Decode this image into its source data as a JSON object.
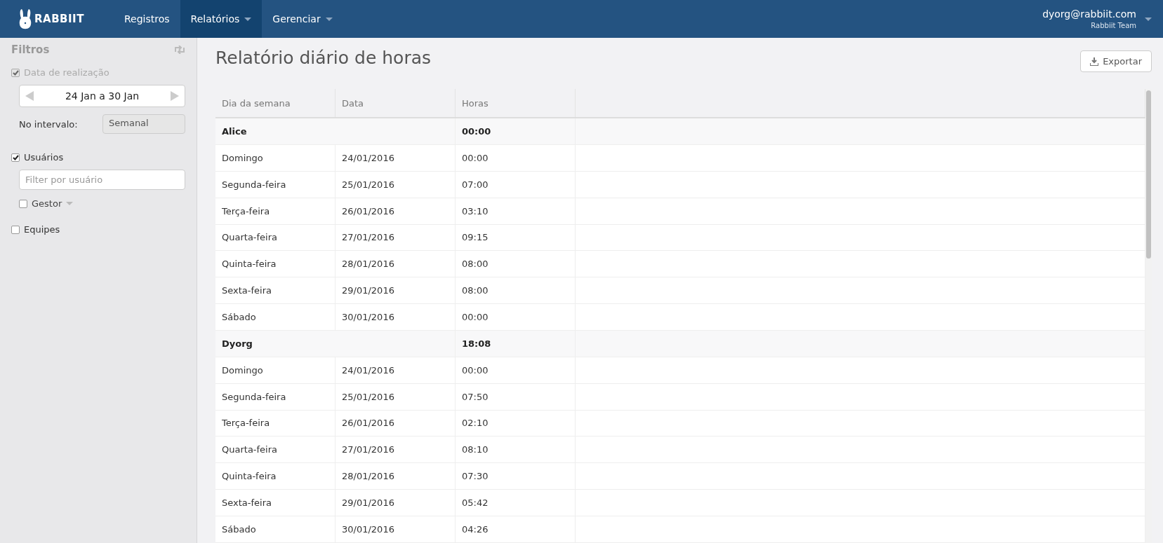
{
  "brand": "RABBIIT",
  "nav": [
    {
      "label": "Registros",
      "selected": false,
      "dropdown": false
    },
    {
      "label": "Relatórios",
      "selected": true,
      "dropdown": true
    },
    {
      "label": "Gerenciar",
      "selected": false,
      "dropdown": true
    }
  ],
  "user": {
    "email": "dyorg@rabbiit.com",
    "team": "Rabbiit Team"
  },
  "filters": {
    "title": "Filtros",
    "date": {
      "label": "Data de realização",
      "checked": true,
      "disabled": true,
      "range": "24 Jan a 30 Jan",
      "interval_label": "No intervalo:",
      "interval": "Semanal"
    },
    "users": {
      "label": "Usuários",
      "checked": true,
      "placeholder": "Filter por usuário",
      "manager": {
        "label": "Gestor",
        "checked": false
      }
    },
    "teams": {
      "label": "Equipes",
      "checked": false
    }
  },
  "page_title": "Relatório diário de horas",
  "export_button": "Exportar",
  "table": {
    "columns": [
      "Dia da semana",
      "Data",
      "Horas"
    ],
    "rows": [
      {
        "kind": "group",
        "name": "Alice",
        "hours": "00:00"
      },
      {
        "kind": "day",
        "day": "Domingo",
        "date": "24/01/2016",
        "hours": "00:00"
      },
      {
        "kind": "day",
        "day": "Segunda-feira",
        "date": "25/01/2016",
        "hours": "07:00"
      },
      {
        "kind": "day",
        "day": "Terça-feira",
        "date": "26/01/2016",
        "hours": "03:10"
      },
      {
        "kind": "day",
        "day": "Quarta-feira",
        "date": "27/01/2016",
        "hours": "09:15"
      },
      {
        "kind": "day",
        "day": "Quinta-feira",
        "date": "28/01/2016",
        "hours": "08:00"
      },
      {
        "kind": "day",
        "day": "Sexta-feira",
        "date": "29/01/2016",
        "hours": "08:00"
      },
      {
        "kind": "day",
        "day": "Sábado",
        "date": "30/01/2016",
        "hours": "00:00"
      },
      {
        "kind": "group",
        "name": "Dyorg",
        "hours": "18:08"
      },
      {
        "kind": "day",
        "day": "Domingo",
        "date": "24/01/2016",
        "hours": "00:00"
      },
      {
        "kind": "day",
        "day": "Segunda-feira",
        "date": "25/01/2016",
        "hours": "07:50"
      },
      {
        "kind": "day",
        "day": "Terça-feira",
        "date": "26/01/2016",
        "hours": "02:10"
      },
      {
        "kind": "day",
        "day": "Quarta-feira",
        "date": "27/01/2016",
        "hours": "08:10"
      },
      {
        "kind": "day",
        "day": "Quinta-feira",
        "date": "28/01/2016",
        "hours": "07:30"
      },
      {
        "kind": "day",
        "day": "Sexta-feira",
        "date": "29/01/2016",
        "hours": "05:42"
      },
      {
        "kind": "day",
        "day": "Sábado",
        "date": "30/01/2016",
        "hours": "04:26"
      }
    ]
  }
}
